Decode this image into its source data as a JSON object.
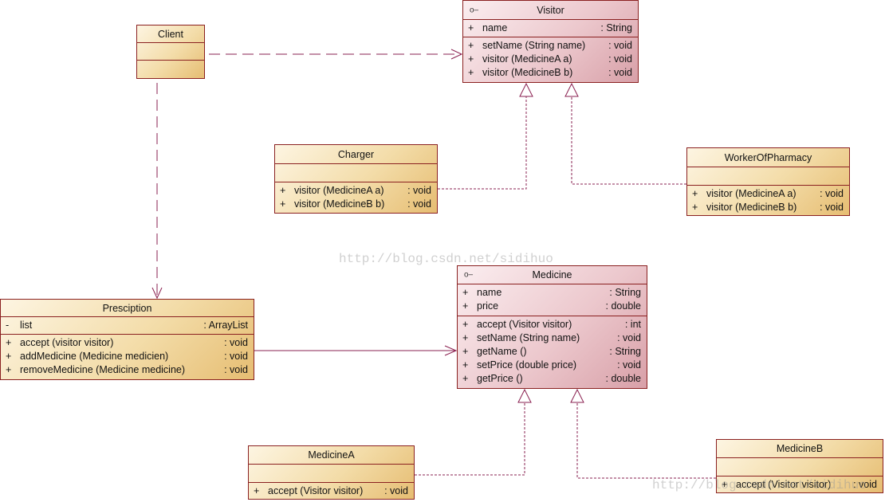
{
  "colors": {
    "border": "#8a2020",
    "class_fill": "#f3dca8",
    "interface_fill": "#ecc8cd",
    "line": "#8a2050"
  },
  "watermark": "http://blog.csdn.net/sidihuo",
  "classes": {
    "client": {
      "name": "Client",
      "attributes": [],
      "methods": []
    },
    "visitor": {
      "name": "Visitor",
      "icon": "interface-icon",
      "attributes": [
        {
          "vis": "+",
          "name": "name",
          "type": ": String"
        }
      ],
      "methods": [
        {
          "vis": "+",
          "name": "setName (String name)",
          "type": ": void"
        },
        {
          "vis": "+",
          "name": "visitor (MedicineA a)",
          "type": ": void"
        },
        {
          "vis": "+",
          "name": "visitor (MedicineB b)",
          "type": ": void"
        }
      ]
    },
    "charger": {
      "name": "Charger",
      "attributes": [],
      "methods": [
        {
          "vis": "+",
          "name": "visitor (MedicineA a)",
          "type": ": void"
        },
        {
          "vis": "+",
          "name": "visitor (MedicineB b)",
          "type": ": void"
        }
      ]
    },
    "worker": {
      "name": "WorkerOfPharmacy",
      "attributes": [],
      "methods": [
        {
          "vis": "+",
          "name": "visitor (MedicineA a)",
          "type": ": void"
        },
        {
          "vis": "+",
          "name": "visitor (MedicineB b)",
          "type": ": void"
        }
      ]
    },
    "prescription": {
      "name": "Presciption",
      "attributes": [
        {
          "vis": "-",
          "name": "list",
          "type": ": ArrayList"
        }
      ],
      "methods": [
        {
          "vis": "+",
          "name": "accept (visitor visitor)",
          "type": ": void"
        },
        {
          "vis": "+",
          "name": "addMedicine (Medicine medicien)",
          "type": ": void"
        },
        {
          "vis": "+",
          "name": "removeMedicine (Medicine medicine)",
          "type": ": void"
        }
      ]
    },
    "medicine": {
      "name": "Medicine",
      "icon": "interface-icon",
      "attributes": [
        {
          "vis": "+",
          "name": "name",
          "type": ": String"
        },
        {
          "vis": "+",
          "name": "price",
          "type": ": double"
        }
      ],
      "methods": [
        {
          "vis": "+",
          "name": "accept (Visitor visitor)",
          "type": ": int"
        },
        {
          "vis": "+",
          "name": "setName (String name)",
          "type": ": void"
        },
        {
          "vis": "+",
          "name": "getName ()",
          "type": ": String"
        },
        {
          "vis": "+",
          "name": "setPrice (double price)",
          "type": ": void"
        },
        {
          "vis": "+",
          "name": "getPrice ()",
          "type": ": double"
        }
      ]
    },
    "medicineA": {
      "name": "MedicineA",
      "attributes": [],
      "methods": [
        {
          "vis": "+",
          "name": "accept (Visitor visitor)",
          "type": ": void"
        }
      ]
    },
    "medicineB": {
      "name": "MedicineB",
      "attributes": [],
      "methods": [
        {
          "vis": "+",
          "name": "accept (Visitor visitor)",
          "type": ": void"
        }
      ]
    }
  },
  "relations": [
    {
      "from": "Client",
      "to": "Visitor",
      "type": "dependency"
    },
    {
      "from": "Client",
      "to": "Presciption",
      "type": "dependency"
    },
    {
      "from": "Charger",
      "to": "Visitor",
      "type": "realization"
    },
    {
      "from": "WorkerOfPharmacy",
      "to": "Visitor",
      "type": "realization"
    },
    {
      "from": "Presciption",
      "to": "Medicine",
      "type": "association"
    },
    {
      "from": "MedicineA",
      "to": "Medicine",
      "type": "realization"
    },
    {
      "from": "MedicineB",
      "to": "Medicine",
      "type": "realization"
    }
  ]
}
